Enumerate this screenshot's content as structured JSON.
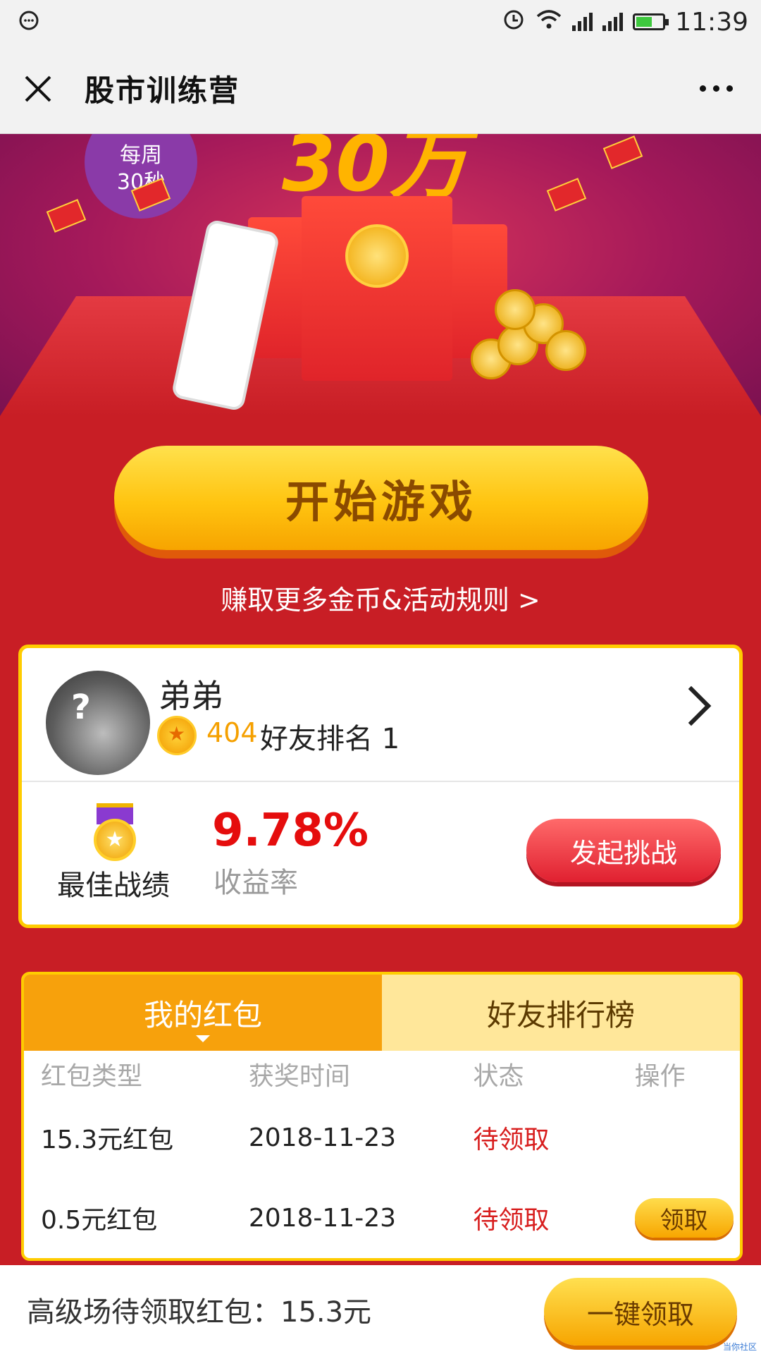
{
  "status_bar": {
    "time": "11:39",
    "battery_level": 0.6
  },
  "header": {
    "title": "股市训练营"
  },
  "banner": {
    "headline": "30万",
    "bubble_line1": "每周",
    "bubble_line2": "30秒"
  },
  "start_button": {
    "label": "开始游戏"
  },
  "rules_link": {
    "label": "赚取更多金币&活动规则 >"
  },
  "profile": {
    "name": "弟弟",
    "coins": "404",
    "rank_label": "好友排名 1",
    "best_label": "最佳战绩",
    "rate": "9.78%",
    "rate_label": "收益率",
    "challenge_label": "发起挑战"
  },
  "panel": {
    "tabs": [
      {
        "label": "我的红包",
        "active": true
      },
      {
        "label": "好友排行榜",
        "active": false
      }
    ],
    "columns": [
      "红包类型",
      "获奖时间",
      "状态",
      "操作"
    ],
    "rows": [
      {
        "type": "15.3元红包",
        "time": "2018-11-23",
        "status": "待领取",
        "action": ""
      },
      {
        "type": "0.5元红包",
        "time": "2018-11-23",
        "status": "待领取",
        "action": "领取"
      }
    ]
  },
  "footer": {
    "text": "高级场待领取红包：15.3元",
    "button": "一键领取"
  },
  "watermark": "当你社区",
  "colors": {
    "accent_red": "#c81e25",
    "gold": "#ffc410",
    "tab_orange": "#f7a10c",
    "status_red": "#d81e1e"
  }
}
